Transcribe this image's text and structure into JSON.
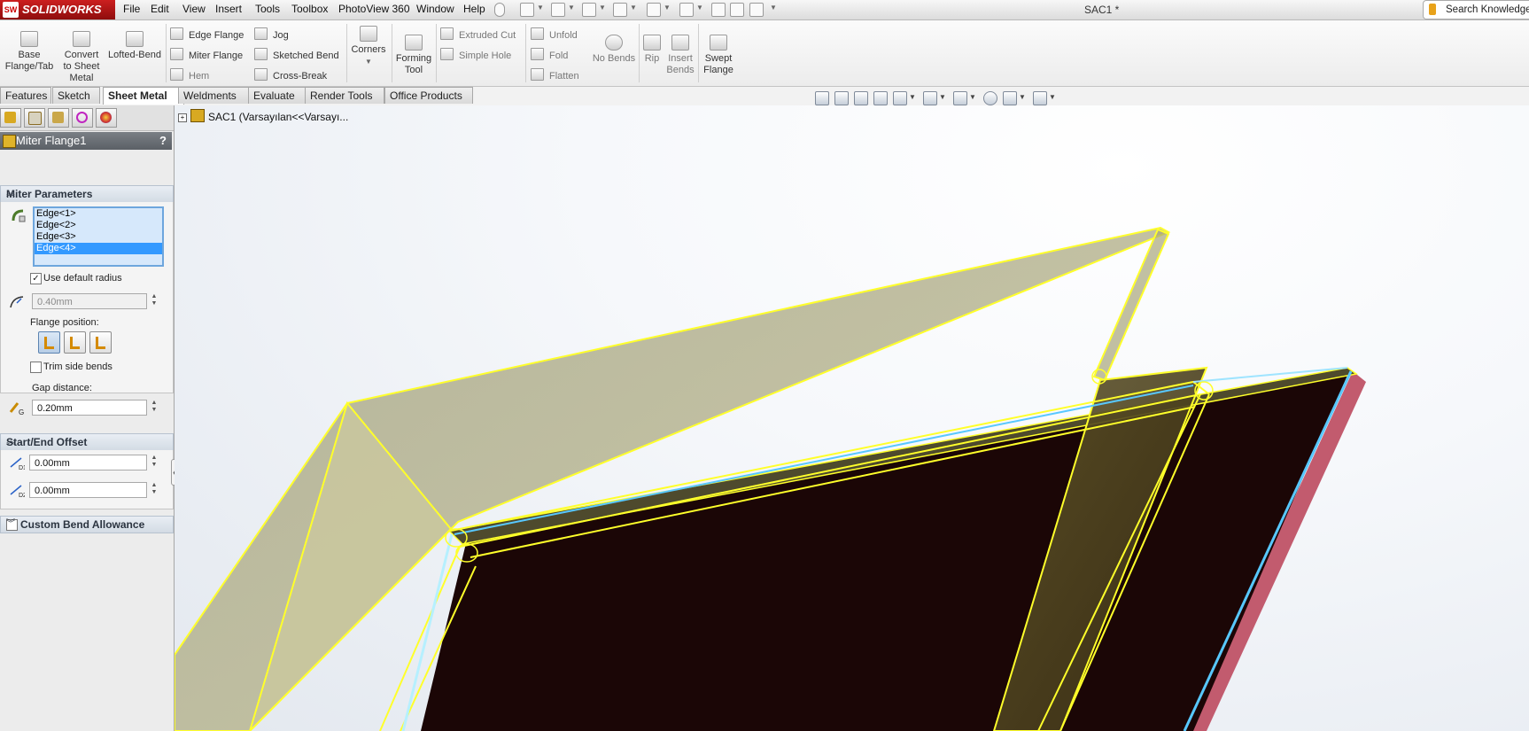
{
  "app": {
    "logo_text": "SOLIDWORKS",
    "logo_mark": "SW",
    "document_title": "SAC1 *",
    "search_placeholder": "Search Knowledge B"
  },
  "menu": [
    "File",
    "Edit",
    "View",
    "Insert",
    "Tools",
    "Toolbox",
    "PhotoView 360",
    "Window",
    "Help"
  ],
  "ribbon": {
    "large_buttons": [
      {
        "id": "base-flange",
        "label_1": "Base",
        "label_2": "Flange/Tab",
        "label_3": "",
        "icon": "base-flange-icon"
      },
      {
        "id": "convert-sheet-metal",
        "label_1": "Convert",
        "label_2": "to Sheet",
        "label_3": "Metal",
        "icon": "convert-icon"
      },
      {
        "id": "lofted-bend",
        "label_1": "Lofted-Bend",
        "label_2": "",
        "label_3": "",
        "icon": "lofted-bend-icon"
      }
    ],
    "column1": [
      "Edge Flange",
      "Miter Flange",
      "Hem"
    ],
    "column2": [
      "Jog",
      "Sketched Bend",
      "Cross-Break"
    ],
    "corners": "Corners",
    "forming_tool_1": "Forming",
    "forming_tool_2": "Tool",
    "column3": [
      "Extruded Cut",
      "Simple Hole"
    ],
    "column4": [
      "Unfold",
      "Fold",
      "Flatten"
    ],
    "no_bends": "No Bends",
    "rip": "Rip",
    "insert_bends_1": "Insert",
    "insert_bends_2": "Bends",
    "swept_flange_1": "Swept",
    "swept_flange_2": "Flange"
  },
  "tabs": [
    {
      "label": "Features",
      "active": false
    },
    {
      "label": "Sketch",
      "active": false
    },
    {
      "label": "Sheet Metal",
      "active": true
    },
    {
      "label": "Weldments",
      "active": false
    },
    {
      "label": "Evaluate",
      "active": false
    },
    {
      "label": "Render Tools",
      "active": false
    },
    {
      "label": "Office Products",
      "active": false
    }
  ],
  "property_manager": {
    "title": "Miter Flange1",
    "help": "?",
    "miter_parameters": {
      "header": "Miter Parameters",
      "edges": [
        "Edge<1>",
        "Edge<2>",
        "Edge<3>",
        "Edge<4>"
      ],
      "selected_edge": 3,
      "use_default_radius_label": "Use default radius",
      "use_default_radius_checked": true,
      "radius_value": "0.40mm",
      "flange_position_label": "Flange position:",
      "trim_side_bends_label": "Trim side bends",
      "trim_side_bends_checked": false,
      "gap_distance_label": "Gap distance:",
      "gap_distance_value": "0.20mm"
    },
    "start_end_offset": {
      "header": "Start/End Offset",
      "d1_value": "0.00mm",
      "d2_value": "0.00mm",
      "d1_sub": "D1",
      "d2_sub": "D2"
    },
    "custom_bend_allowance": {
      "header": "Custom Bend Allowance",
      "checked": false
    }
  },
  "feature_tree": {
    "root_label": "SAC1  (Varsayılan<<Varsayı..."
  },
  "colors": {
    "selection_yellow": "#ffff2a",
    "preview_fill": "#b7b488",
    "body_dark": "#1a0606",
    "edge_cyan": "#58c8ff",
    "edge_red": "#c0586c",
    "logo_red": "#b51515"
  }
}
